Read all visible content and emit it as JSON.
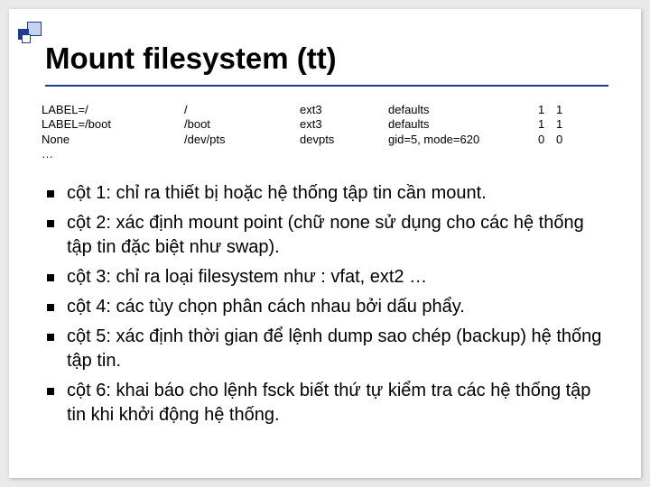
{
  "title": "Mount filesystem (tt)",
  "table": {
    "rows": [
      {
        "c1": "LABEL=/",
        "c2": "/",
        "c3": "ext3",
        "c4": "defaults",
        "c5": "1",
        "c6": "1"
      },
      {
        "c1": "LABEL=/boot",
        "c2": "/boot",
        "c3": "ext3",
        "c4": " defaults",
        "c5": "1",
        "c6": "1"
      },
      {
        "c1": "None",
        "c2": "/dev/pts",
        "c3": "devpts",
        "c4": "gid=5, mode=620",
        "c5": "0",
        "c6": "0"
      },
      {
        "c1": "…",
        "c2": "",
        "c3": "",
        "c4": "",
        "c5": "",
        "c6": ""
      }
    ]
  },
  "bullets": [
    "cột 1: chỉ ra thiết bị hoặc hệ thống tập tin cần mount.",
    "cột 2: xác định mount point (chữ none sử dụng cho các hệ thống tập tin đặc biệt như swap).",
    "cột 3: chỉ ra loại filesystem như : vfat, ext2 …",
    "cột 4: các tùy chọn phân cách nhau bởi dấu phẩy.",
    "cột 5: xác định thời gian để lệnh dump sao chép (backup) hệ thống tập tin.",
    "cột 6: khai báo cho lệnh fsck biết thứ tự kiểm tra các hệ thống tập tin khi khởi động hệ thống."
  ]
}
